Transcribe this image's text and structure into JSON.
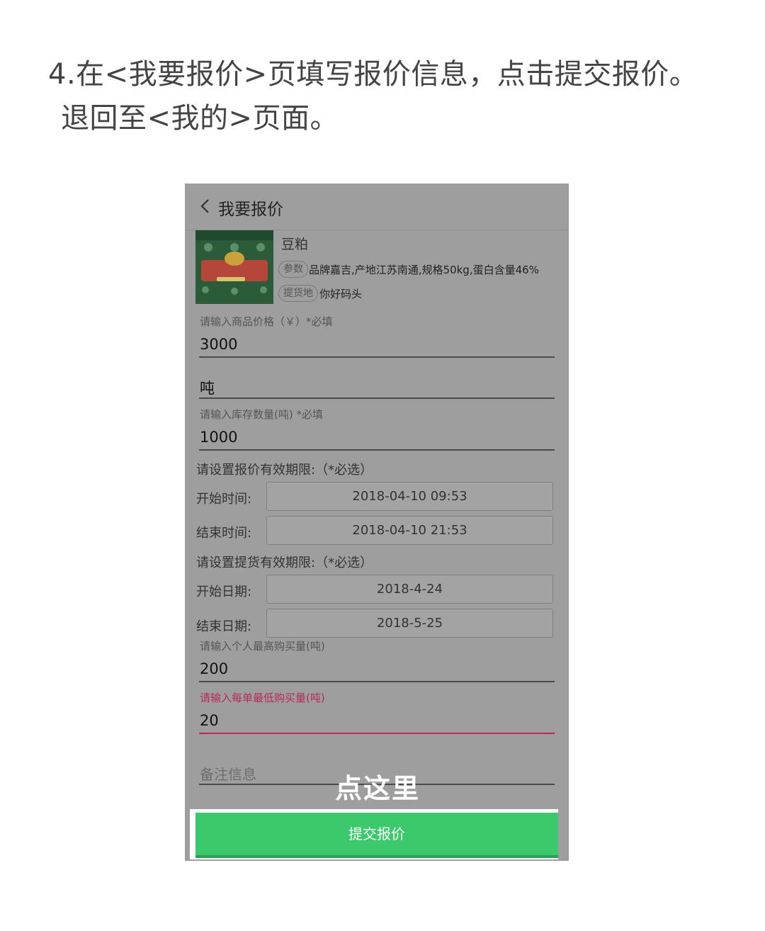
{
  "instruction": {
    "line1": "4.在<我要报价>页填写报价信息，点击提交报价。",
    "line2": "退回至<我的>页面。"
  },
  "screen": {
    "title": "我要报价",
    "product": {
      "name": "豆粕",
      "param_tag": "参数",
      "params": "品牌嘉吉,产地江苏南通,规格50kg,蛋白含量46%",
      "location_tag": "提货地",
      "location": "你好码头"
    },
    "price": {
      "label": "请输入商品价格（￥）*必填",
      "value": "3000"
    },
    "unit": {
      "value": "吨"
    },
    "stock": {
      "label": "请输入库存数量(吨) *必填",
      "value": "1000"
    },
    "quote_period": {
      "label": "请设置报价有效期限:（*必选）",
      "start_label": "开始时间:",
      "start_value": "2018-04-10 09:53",
      "end_label": "结束时间:",
      "end_value": "2018-04-10 21:53"
    },
    "pickup_period": {
      "label": "请设置提货有效期限:（*必选）",
      "start_label": "开始日期:",
      "start_value": "2018-4-24",
      "end_label": "结束日期:",
      "end_value": "2018-5-25"
    },
    "max_purchase": {
      "label": "请输入个人最高购买量(吨)",
      "value": "200"
    },
    "min_purchase": {
      "label": "请输入每单最低购买量(吨)",
      "value": "20"
    },
    "remark": {
      "placeholder": "备注信息"
    },
    "submit_label": "提交报价",
    "hint": "点这里"
  },
  "colors": {
    "submit": "#3cc96c",
    "active_field": "#b8285a",
    "overlay": "#9e9e9e"
  }
}
